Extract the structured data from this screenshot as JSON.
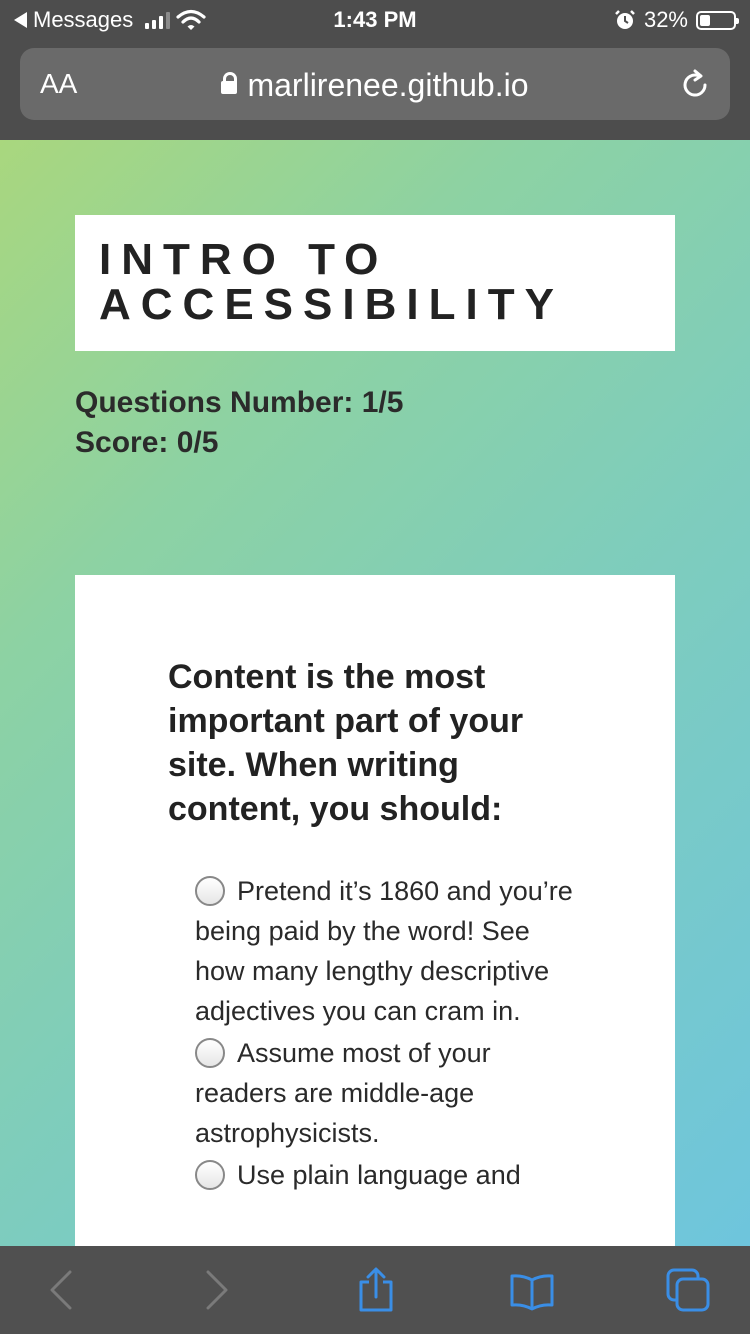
{
  "status_bar": {
    "back_app": "Messages",
    "time": "1:43 PM",
    "battery_percent": "32%",
    "battery_level": 0.32,
    "icons": [
      "signal-icon",
      "wifi-icon",
      "alarm-icon",
      "battery-icon"
    ]
  },
  "browser": {
    "text_size_label": "AA",
    "url": "marlirenee.github.io",
    "icons": [
      "lock-icon",
      "reload-icon"
    ]
  },
  "header": {
    "title_line1": "INTRO TO",
    "title_line2": "ACCESSIBILITY"
  },
  "quiz": {
    "question_number": "Questions Number: 1/5",
    "score": "Score: 0/5",
    "question": "Content is the most important part of your site. When writing content, you should:",
    "options": [
      "Pretend it’s 1860 and you’re being paid by the word! See how many lengthy descriptive adjectives you can cram in.",
      "Assume most of your readers are middle-age astrophysicists.",
      "Use plain language and"
    ]
  },
  "toolbar": {
    "icons": [
      "back-icon",
      "forward-icon",
      "share-icon",
      "bookmarks-icon",
      "tabs-icon"
    ]
  },
  "colors": {
    "gradient_start": "#a9d77e",
    "gradient_end": "#6ec5dd",
    "toolbar_accent": "#3a8ee6",
    "chrome_bg": "#4d4d4d"
  }
}
